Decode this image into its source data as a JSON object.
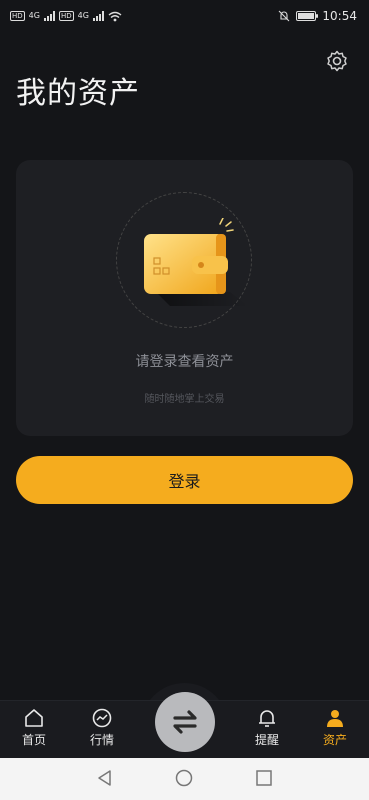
{
  "status": {
    "left_icons": [
      "hd-icon",
      "signal-4g-icon",
      "hd-icon",
      "signal-4g-icon",
      "wifi-icon"
    ],
    "net_label": "4G",
    "hd_label": "HD",
    "time": "10:54"
  },
  "header": {
    "title": "我的资产",
    "settings_icon": "gear-icon"
  },
  "card": {
    "hint": "请登录查看资产",
    "sub": "随时随地掌上交易"
  },
  "login_button": {
    "label": "登录"
  },
  "tabbar": {
    "items": [
      {
        "label": "首页",
        "icon": "home-icon"
      },
      {
        "label": "行情",
        "icon": "chart-icon"
      },
      {
        "label": "",
        "icon": "swap-icon"
      },
      {
        "label": "提醒",
        "icon": "bell-icon"
      },
      {
        "label": "资产",
        "icon": "user-icon",
        "active": true
      }
    ]
  },
  "colors": {
    "accent": "#f5ac1e",
    "background": "#141518",
    "card": "#1e1f23"
  }
}
